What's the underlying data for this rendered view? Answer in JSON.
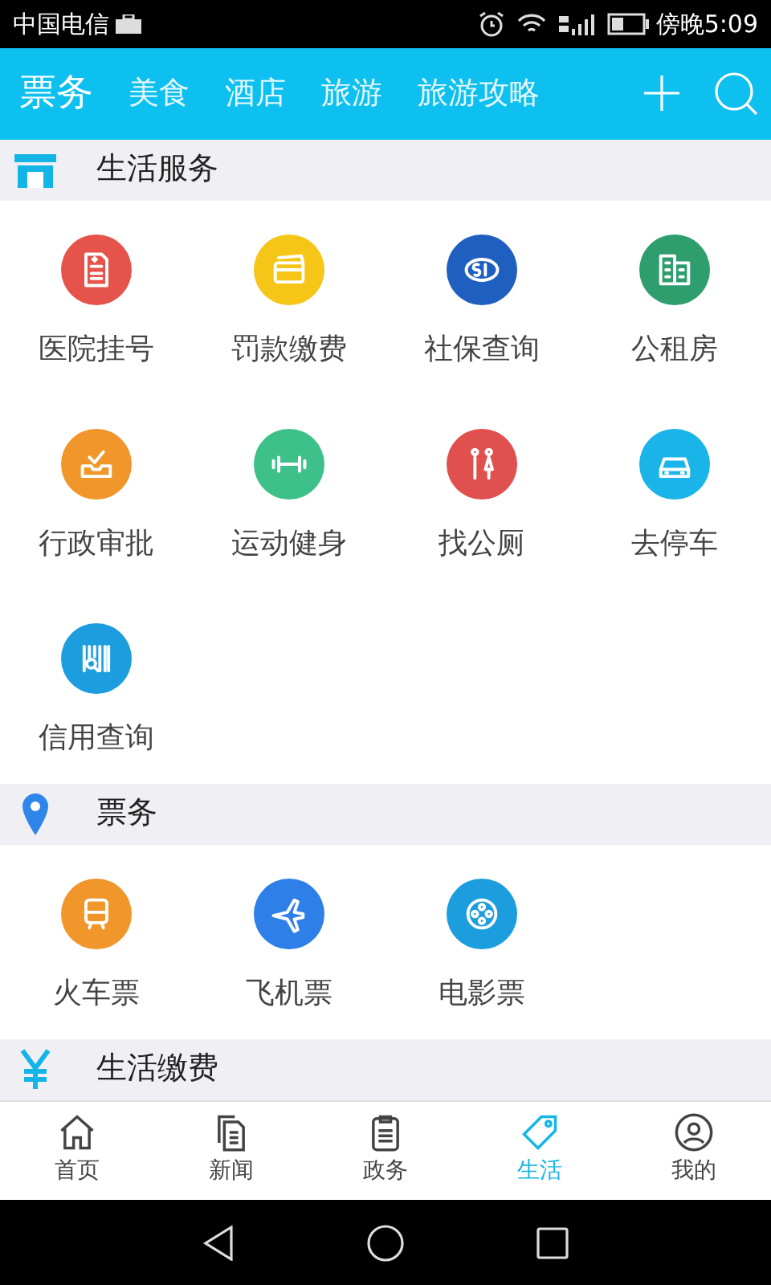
{
  "status_bar": {
    "carrier": "中国电信",
    "time": "傍晚5:09"
  },
  "top_tabs": [
    {
      "label": "票务",
      "selected": true
    },
    {
      "label": "美食",
      "selected": false
    },
    {
      "label": "酒店",
      "selected": false
    },
    {
      "label": "旅游",
      "selected": false
    },
    {
      "label": "旅游攻略",
      "selected": false
    }
  ],
  "sections": [
    {
      "title": "生活服务",
      "items": [
        {
          "label": "医院挂号",
          "color": "#e5534b"
        },
        {
          "label": "罚款缴费",
          "color": "#f5c518"
        },
        {
          "label": "社保查询",
          "color": "#1f5fbf"
        },
        {
          "label": "公租房",
          "color": "#2f9e6e"
        },
        {
          "label": "行政审批",
          "color": "#f0962a"
        },
        {
          "label": "运动健身",
          "color": "#3ec08a"
        },
        {
          "label": "找公厕",
          "color": "#e0504f"
        },
        {
          "label": "去停车",
          "color": "#1bb4e8"
        },
        {
          "label": "信用查询",
          "color": "#1c9ede"
        }
      ]
    },
    {
      "title": "票务",
      "items": [
        {
          "label": "火车票",
          "color": "#f0962a"
        },
        {
          "label": "飞机票",
          "color": "#2f7fe8"
        },
        {
          "label": "电影票",
          "color": "#1c9ede"
        }
      ]
    },
    {
      "title": "生活缴费"
    }
  ],
  "bottom_nav": [
    {
      "label": "首页",
      "selected": false
    },
    {
      "label": "新闻",
      "selected": false
    },
    {
      "label": "政务",
      "selected": false
    },
    {
      "label": "生活",
      "selected": true
    },
    {
      "label": "我的",
      "selected": false
    }
  ]
}
